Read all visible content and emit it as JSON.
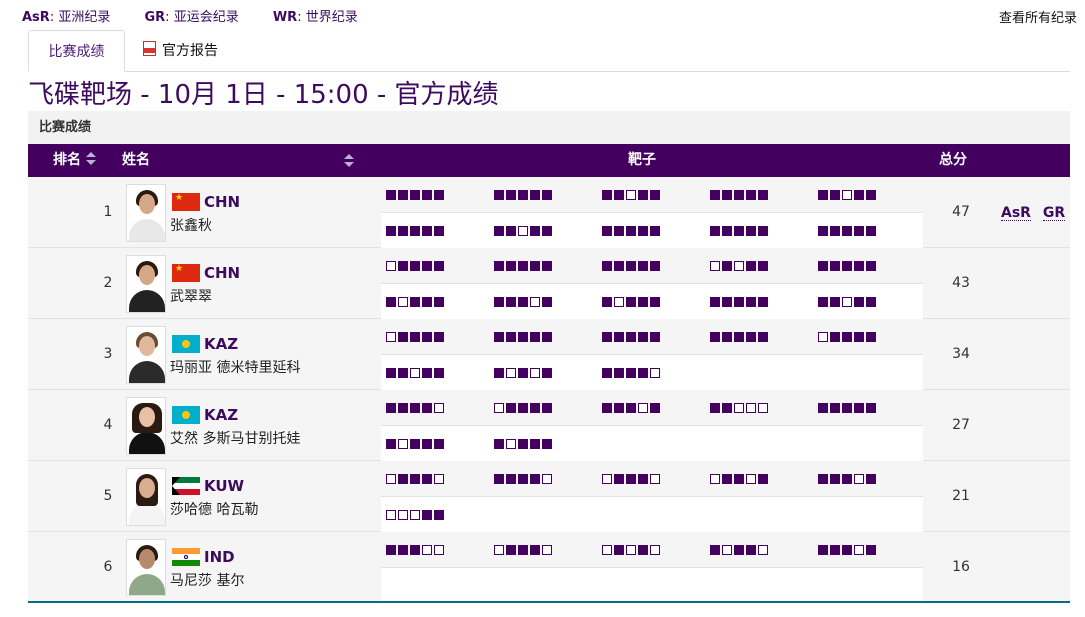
{
  "records_legend": [
    {
      "code": "AsR",
      "label": "亚洲纪录"
    },
    {
      "code": "GR",
      "label": "亚运会纪录"
    },
    {
      "code": "WR",
      "label": "世界纪录"
    }
  ],
  "view_all_records": "查看所有纪录",
  "tabs": [
    {
      "label": "比赛成绩",
      "active": true
    },
    {
      "label": "官方报告",
      "icon": "pdf-icon"
    }
  ],
  "page_title": "飞碟靶场 - 10月 1日 - 15:00 - 官方成绩",
  "section_title": "比赛成绩",
  "table_header": {
    "rank": "排名",
    "name": "姓名",
    "targets": "靶子",
    "total": "总分"
  },
  "colors": {
    "accent": "#43005f",
    "title": "#3c0a5e",
    "row_bg": "#f5f5f5"
  },
  "results": [
    {
      "rank": "1",
      "noc": "CHN",
      "flag": "chn",
      "name": "张鑫秋",
      "total": "47",
      "records": [
        "AsR",
        "GR"
      ],
      "line1": [
        "11111",
        "11111",
        "11011",
        "11111",
        "11011"
      ],
      "line2": [
        "11111",
        "11011",
        "11111",
        "11111",
        "11111"
      ]
    },
    {
      "rank": "2",
      "noc": "CHN",
      "flag": "chn",
      "name": "武翠翠",
      "total": "43",
      "records": [],
      "line1": [
        "01111",
        "11111",
        "11111",
        "01011",
        "11111"
      ],
      "line2": [
        "10111",
        "11101",
        "10111",
        "11111",
        "11011"
      ]
    },
    {
      "rank": "3",
      "noc": "KAZ",
      "flag": "kaz",
      "name": "玛丽亚 德米特里延科",
      "total": "34",
      "records": [],
      "line1": [
        "01111",
        "11111",
        "11111",
        "11111",
        "01111"
      ],
      "line2": [
        "11011",
        "10101",
        "11110"
      ]
    },
    {
      "rank": "4",
      "noc": "KAZ",
      "flag": "kaz",
      "name": "艾然 多斯马甘别托娃",
      "total": "27",
      "records": [],
      "line1": [
        "11110",
        "01111",
        "11101",
        "11000",
        "11111"
      ],
      "line2": [
        "10111",
        "10111"
      ]
    },
    {
      "rank": "5",
      "noc": "KUW",
      "flag": "kuw",
      "name": "莎哈德 哈瓦勒",
      "total": "21",
      "records": [],
      "line1": [
        "01110",
        "11110",
        "01110",
        "01101",
        "11101"
      ],
      "line2": [
        "00011"
      ]
    },
    {
      "rank": "6",
      "noc": "IND",
      "flag": "ind",
      "name": "马尼莎 基尔",
      "total": "16",
      "records": [],
      "line1": [
        "11100",
        "01110",
        "01010",
        "10110",
        "11101"
      ],
      "line2": []
    }
  ]
}
